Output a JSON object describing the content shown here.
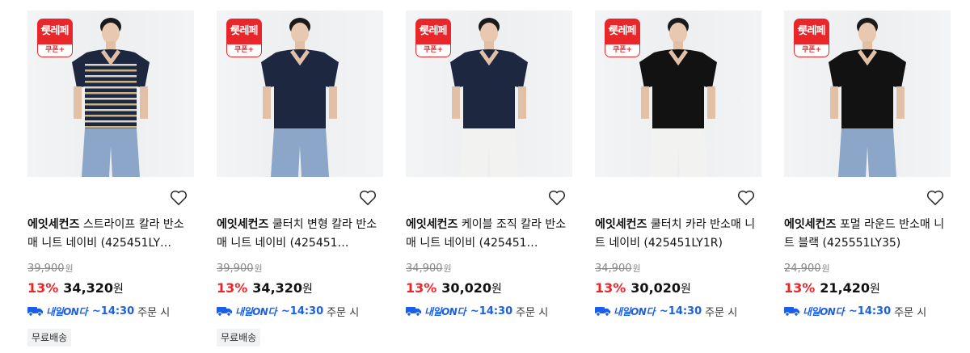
{
  "badge": {
    "top_label": "롯레페",
    "bottom_label": "쿠폰+"
  },
  "delivery": {
    "service_label": "내일ON다",
    "cutoff": "~14:30",
    "suffix": "주문 시"
  },
  "colors": {
    "accent_red": "#e9272b",
    "delivery_blue": "#1b5fe8"
  },
  "products": [
    {
      "brand": "에잇세컨즈",
      "name": "스트라이프 칼라 반소매 니트 네이비 (425451LY…",
      "original_price": "39,900",
      "discount_rate": "13%",
      "sale_price": "34,320",
      "won": "원",
      "free_shipping": "무료배송",
      "shirt": "stripe",
      "pants": "jeans"
    },
    {
      "brand": "에잇세컨즈",
      "name": "쿨터치 변형 칼라 반소매 니트 네이비 (425451…",
      "original_price": "39,900",
      "discount_rate": "13%",
      "sale_price": "34,320",
      "won": "원",
      "free_shipping": "무료배송",
      "shirt": "navy",
      "pants": "jeans"
    },
    {
      "brand": "에잇세컨즈",
      "name": "케이블 조직 칼라 반소매 니트 네이비 (425451…",
      "original_price": "34,900",
      "discount_rate": "13%",
      "sale_price": "30,020",
      "won": "원",
      "free_shipping": "",
      "shirt": "navy",
      "pants": "white"
    },
    {
      "brand": "에잇세컨즈",
      "name": "쿨터치 카라 반소매 니트 네이비 (425451LY1R)",
      "original_price": "34,900",
      "discount_rate": "13%",
      "sale_price": "30,020",
      "won": "원",
      "free_shipping": "",
      "shirt": "black",
      "pants": "white"
    },
    {
      "brand": "에잇세컨즈",
      "name": "포멀 라운드 반소매 니트 블랙 (425551LY35)",
      "original_price": "24,900",
      "discount_rate": "13%",
      "sale_price": "21,420",
      "won": "원",
      "free_shipping": "",
      "shirt": "black",
      "pants": "jeans"
    }
  ]
}
